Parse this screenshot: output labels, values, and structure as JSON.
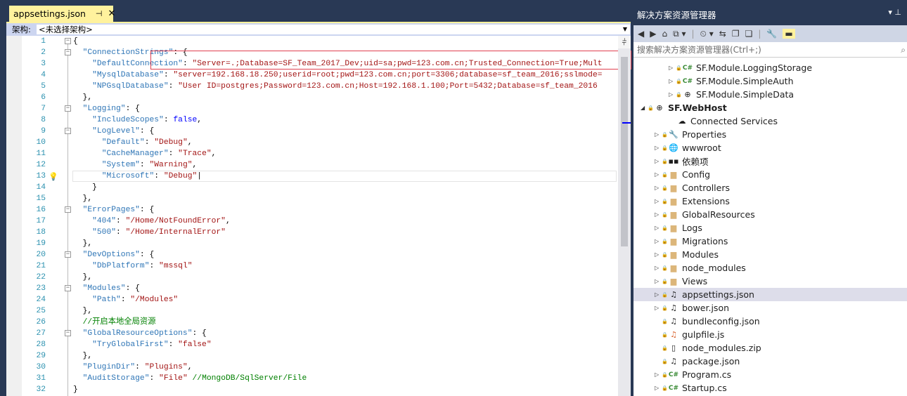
{
  "editor": {
    "tab_label": "appsettings.json",
    "pin_icon": "pin-icon",
    "close_icon": "close-icon",
    "nav_label": "架构:",
    "nav_value": "<未选择架构>"
  },
  "code_lines": [
    [
      [
        "p",
        "{"
      ]
    ],
    [
      [
        "p",
        "  "
      ],
      [
        "k",
        "\"ConnectionStrings\""
      ],
      [
        "p",
        ": {"
      ]
    ],
    [
      [
        "p",
        "    "
      ],
      [
        "k",
        "\"DefaultConnection\""
      ],
      [
        "p",
        ": "
      ],
      [
        "s",
        "\"Server=.;Database=SF_Team_2017_Dev;uid=sa;pwd=123.com.cn;Trusted_Connection=True;Mult"
      ]
    ],
    [
      [
        "p",
        "    "
      ],
      [
        "k",
        "\"MysqlDatabase\""
      ],
      [
        "p",
        ": "
      ],
      [
        "s",
        "\"server=192.168.18.250;userid=root;pwd=123.com.cn;port=3306;database=sf_team_2016;sslmode="
      ]
    ],
    [
      [
        "p",
        "    "
      ],
      [
        "k",
        "\"NPGsqlDatabase\""
      ],
      [
        "p",
        ": "
      ],
      [
        "s",
        "\"User ID=postgres;Password=123.com.cn;Host=192.168.1.100;Port=5432;Database=sf_team_2016"
      ]
    ],
    [
      [
        "p",
        "  },"
      ]
    ],
    [
      [
        "p",
        "  "
      ],
      [
        "k",
        "\"Logging\""
      ],
      [
        "p",
        ": {"
      ]
    ],
    [
      [
        "p",
        "    "
      ],
      [
        "k",
        "\"IncludeScopes\""
      ],
      [
        "p",
        ": "
      ],
      [
        "b",
        "false"
      ],
      [
        "p",
        ","
      ]
    ],
    [
      [
        "p",
        "    "
      ],
      [
        "k",
        "\"LogLevel\""
      ],
      [
        "p",
        ": {"
      ]
    ],
    [
      [
        "p",
        "      "
      ],
      [
        "k",
        "\"Default\""
      ],
      [
        "p",
        ": "
      ],
      [
        "s",
        "\"Debug\""
      ],
      [
        "p",
        ","
      ]
    ],
    [
      [
        "p",
        "      "
      ],
      [
        "k",
        "\"CacheManager\""
      ],
      [
        "p",
        ": "
      ],
      [
        "s",
        "\"Trace\""
      ],
      [
        "p",
        ","
      ]
    ],
    [
      [
        "p",
        "      "
      ],
      [
        "k",
        "\"System\""
      ],
      [
        "p",
        ": "
      ],
      [
        "s",
        "\"Warning\""
      ],
      [
        "p",
        ","
      ]
    ],
    [
      [
        "p",
        "      "
      ],
      [
        "k",
        "\"Microsoft\""
      ],
      [
        "p",
        ": "
      ],
      [
        "s",
        "\"Debug\""
      ],
      [
        "p",
        "|"
      ]
    ],
    [
      [
        "p",
        "    }"
      ]
    ],
    [
      [
        "p",
        "  },"
      ]
    ],
    [
      [
        "p",
        "  "
      ],
      [
        "k",
        "\"ErrorPages\""
      ],
      [
        "p",
        ": {"
      ]
    ],
    [
      [
        "p",
        "    "
      ],
      [
        "k",
        "\"404\""
      ],
      [
        "p",
        ": "
      ],
      [
        "s",
        "\"/Home/NotFoundError\""
      ],
      [
        "p",
        ","
      ]
    ],
    [
      [
        "p",
        "    "
      ],
      [
        "k",
        "\"500\""
      ],
      [
        "p",
        ": "
      ],
      [
        "s",
        "\"/Home/InternalError\""
      ]
    ],
    [
      [
        "p",
        "  },"
      ]
    ],
    [
      [
        "p",
        "  "
      ],
      [
        "k",
        "\"DevOptions\""
      ],
      [
        "p",
        ": {"
      ]
    ],
    [
      [
        "p",
        "    "
      ],
      [
        "k",
        "\"DbPlatform\""
      ],
      [
        "p",
        ": "
      ],
      [
        "s",
        "\"mssql\""
      ]
    ],
    [
      [
        "p",
        "  },"
      ]
    ],
    [
      [
        "p",
        "  "
      ],
      [
        "k",
        "\"Modules\""
      ],
      [
        "p",
        ": {"
      ]
    ],
    [
      [
        "p",
        "    "
      ],
      [
        "k",
        "\"Path\""
      ],
      [
        "p",
        ": "
      ],
      [
        "s",
        "\"/Modules\""
      ]
    ],
    [
      [
        "p",
        "  },"
      ]
    ],
    [
      [
        "p",
        "  "
      ],
      [
        "c",
        "//开启本地全局资源"
      ]
    ],
    [
      [
        "p",
        "  "
      ],
      [
        "k",
        "\"GlobalResourceOptions\""
      ],
      [
        "p",
        ": {"
      ]
    ],
    [
      [
        "p",
        "    "
      ],
      [
        "k",
        "\"TryGlobalFirst\""
      ],
      [
        "p",
        ": "
      ],
      [
        "s",
        "\"false\""
      ]
    ],
    [
      [
        "p",
        "  },"
      ]
    ],
    [
      [
        "p",
        "  "
      ],
      [
        "k",
        "\"PluginDir\""
      ],
      [
        "p",
        ": "
      ],
      [
        "s",
        "\"Plugins\""
      ],
      [
        "p",
        ","
      ]
    ],
    [
      [
        "p",
        "  "
      ],
      [
        "k",
        "\"AuditStorage\""
      ],
      [
        "p",
        ": "
      ],
      [
        "s",
        "\"File\""
      ],
      [
        "p",
        " "
      ],
      [
        "c",
        "//MongoDB/SqlServer/File"
      ]
    ],
    [
      [
        "p",
        "}"
      ]
    ]
  ],
  "fold_lines": [
    1,
    2,
    7,
    9,
    16,
    20,
    23,
    27
  ],
  "current_line": 13,
  "solution_explorer": {
    "title": "解决方案资源管理器",
    "title_controls": "▾ ⊥",
    "toolbar": [
      "◀",
      "▶",
      "⌂",
      "⧉ ▾",
      "|",
      "⏲ ▾",
      "⇆",
      "❐",
      "❏",
      "|",
      "🔧"
    ],
    "toolbar_active": "▬",
    "search_placeholder": "搜索解决方案资源管理器(Ctrl+;)",
    "search_icon": "search-icon",
    "items": [
      {
        "label": "SF.Module.LoggingStorage",
        "icon": "cs",
        "indent": 2,
        "arrow": "▷"
      },
      {
        "label": "SF.Module.SimpleAuth",
        "icon": "cs",
        "indent": 2,
        "arrow": "▷"
      },
      {
        "label": "SF.Module.SimpleData",
        "icon": "web",
        "indent": 2,
        "arrow": "▷"
      },
      {
        "label": "SF.WebHost",
        "icon": "web",
        "indent": 0,
        "arrow": "◢",
        "bold": true
      },
      {
        "label": "Connected Services",
        "icon": "cloud",
        "indent": 2,
        "arrow": ""
      },
      {
        "label": "Properties",
        "icon": "wrench",
        "indent": 1,
        "arrow": "▷"
      },
      {
        "label": "wwwroot",
        "icon": "globe",
        "indent": 1,
        "arrow": "▷"
      },
      {
        "label": "依赖项",
        "icon": "deps",
        "indent": 1,
        "arrow": "▷"
      },
      {
        "label": "Config",
        "icon": "folder",
        "indent": 1,
        "arrow": "▷"
      },
      {
        "label": "Controllers",
        "icon": "folder",
        "indent": 1,
        "arrow": "▷"
      },
      {
        "label": "Extensions",
        "icon": "folder",
        "indent": 1,
        "arrow": "▷"
      },
      {
        "label": "GlobalResources",
        "icon": "folder",
        "indent": 1,
        "arrow": "▷"
      },
      {
        "label": "Logs",
        "icon": "folder",
        "indent": 1,
        "arrow": "▷"
      },
      {
        "label": "Migrations",
        "icon": "folder",
        "indent": 1,
        "arrow": "▷"
      },
      {
        "label": "Modules",
        "icon": "folder",
        "indent": 1,
        "arrow": "▷"
      },
      {
        "label": "node_modules",
        "icon": "folder",
        "indent": 1,
        "arrow": "▷"
      },
      {
        "label": "Views",
        "icon": "folder",
        "indent": 1,
        "arrow": "▷"
      },
      {
        "label": "appsettings.json",
        "icon": "json",
        "indent": 1,
        "arrow": "▷",
        "selected": true
      },
      {
        "label": "bower.json",
        "icon": "json",
        "indent": 1,
        "arrow": "▷"
      },
      {
        "label": "bundleconfig.json",
        "icon": "json",
        "indent": 1,
        "arrow": ""
      },
      {
        "label": "gulpfile.js",
        "icon": "js",
        "indent": 1,
        "arrow": ""
      },
      {
        "label": "node_modules.zip",
        "icon": "file",
        "indent": 1,
        "arrow": ""
      },
      {
        "label": "package.json",
        "icon": "json",
        "indent": 1,
        "arrow": ""
      },
      {
        "label": "Program.cs",
        "icon": "cs",
        "indent": 1,
        "arrow": "▷"
      },
      {
        "label": "Startup.cs",
        "icon": "cs",
        "indent": 1,
        "arrow": "▷"
      }
    ]
  },
  "colors": {
    "key": "#2e75b6",
    "string": "#a31515",
    "keyword": "#0000ff",
    "comment": "#008000",
    "tab_active": "#fff29d",
    "chrome": "#293955"
  }
}
